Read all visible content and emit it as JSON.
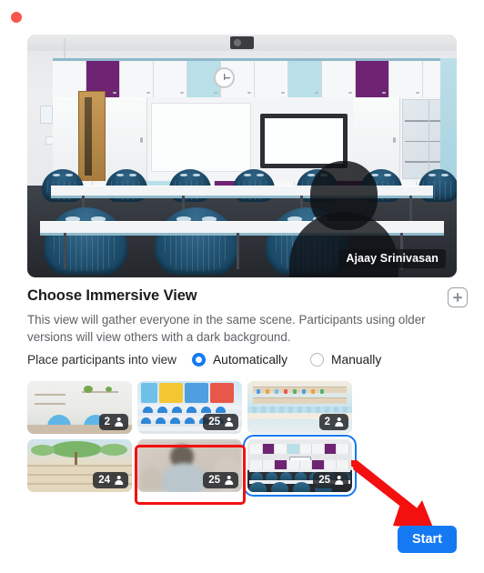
{
  "window": {
    "close_button": "close",
    "title": ""
  },
  "preview": {
    "participant_name": "Ajaay Srinivasan",
    "scene": "classroom"
  },
  "section": {
    "title": "Choose Immersive View",
    "description": "This view will gather everyone in the same scene. Participants using older versions will view others with a dark background.",
    "add_button_label": "+"
  },
  "placement": {
    "label": "Place participants into view",
    "options": [
      {
        "label": "Automatically",
        "selected": true
      },
      {
        "label": "Manually",
        "selected": false
      }
    ]
  },
  "scenes": [
    {
      "name": "Lounge",
      "capacity": "2",
      "selected": false
    },
    {
      "name": "Colorful Classroom",
      "capacity": "25",
      "selected": false
    },
    {
      "name": "Cafe Kitchen",
      "capacity": "2",
      "selected": false
    },
    {
      "name": "Outdoor Amphitheater",
      "capacity": "24",
      "selected": false
    },
    {
      "name": "Blurred Room",
      "capacity": "25",
      "selected": false
    },
    {
      "name": "Classroom",
      "capacity": "25",
      "selected": true
    }
  ],
  "footer": {
    "start_label": "Start"
  },
  "annotations": {
    "highlight_target": "Classroom scene thumbnail",
    "arrow_target": "Start button"
  },
  "colors": {
    "accent": "#1479f2",
    "annotation": "#f2110f",
    "close_dot": "#f9574b",
    "title_text": "#1b1d20",
    "body_text": "#5d6166"
  }
}
